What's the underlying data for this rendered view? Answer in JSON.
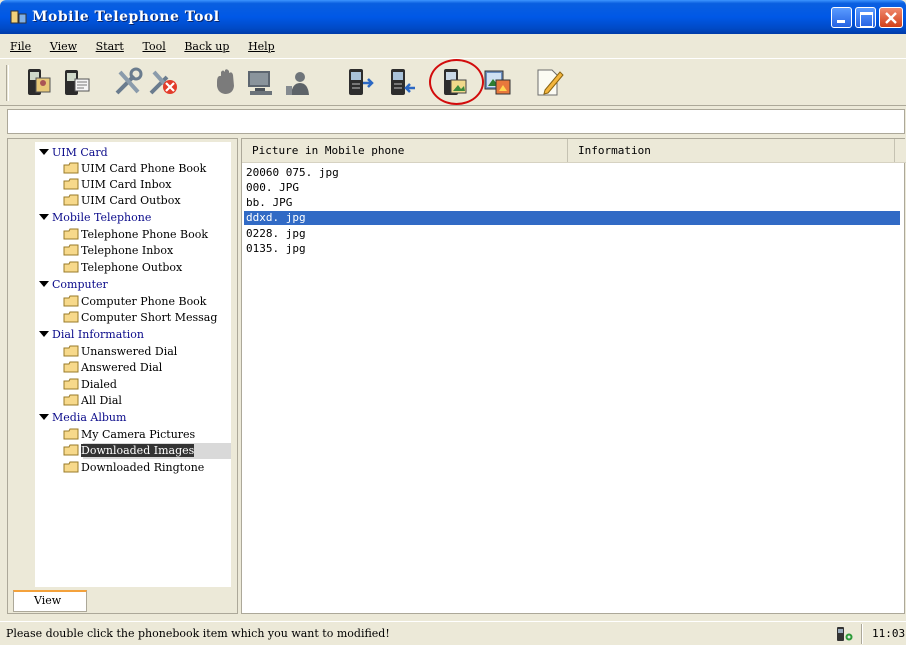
{
  "window": {
    "title": "Mobile Telephone Tool"
  },
  "menu": [
    {
      "label": "File"
    },
    {
      "label": "View"
    },
    {
      "label": "Start"
    },
    {
      "label": "Tool"
    },
    {
      "label": "Back up"
    },
    {
      "label": "Help"
    }
  ],
  "toolbar": {
    "buttons": [
      {
        "icon": "phone-card-icon"
      },
      {
        "icon": "phone-edit-icon"
      },
      {
        "icon": "tools-icon"
      },
      {
        "icon": "tools-delete-icon"
      },
      {
        "icon": "hand-icon"
      },
      {
        "icon": "computer-icon"
      },
      {
        "icon": "user-icon"
      },
      {
        "icon": "phone-export-icon"
      },
      {
        "icon": "phone-import-icon"
      },
      {
        "icon": "phone-picture-icon"
      },
      {
        "icon": "picture-transfer-icon"
      },
      {
        "icon": "note-edit-icon"
      }
    ]
  },
  "tree": {
    "groups": [
      {
        "label": "UIM Card",
        "items": [
          "UIM Card Phone Book",
          "UIM Card Inbox",
          "UIM Card Outbox"
        ]
      },
      {
        "label": "Mobile Telephone",
        "items": [
          "Telephone Phone Book",
          "Telephone Inbox",
          "Telephone Outbox"
        ]
      },
      {
        "label": "Computer",
        "items": [
          "Computer Phone Book",
          "Computer Short Messag"
        ]
      },
      {
        "label": "Dial Information",
        "items": [
          "Unanswered Dial",
          "Answered Dial",
          "Dialed",
          "All Dial"
        ]
      },
      {
        "label": "Media Album",
        "items": [
          "My Camera Pictures",
          "Downloaded Images",
          "Downloaded Ringtone"
        ]
      }
    ],
    "selected": "Downloaded Images",
    "tab_label": "View"
  },
  "list": {
    "columns": [
      "Picture in Mobile phone",
      "Information"
    ],
    "rows": [
      "20060 075. jpg",
      "000. JPG",
      "bb. JPG",
      "ddxd. jpg",
      "0228. jpg",
      "0135. jpg"
    ],
    "selected_row": "ddxd. jpg"
  },
  "status": {
    "message": "Please double click the phonebook item which you want to modified!",
    "clock": "11:03"
  },
  "colors": {
    "titlebar": "#0058e6",
    "selection": "#316ac5",
    "highlight_circle": "#d20c0c"
  }
}
